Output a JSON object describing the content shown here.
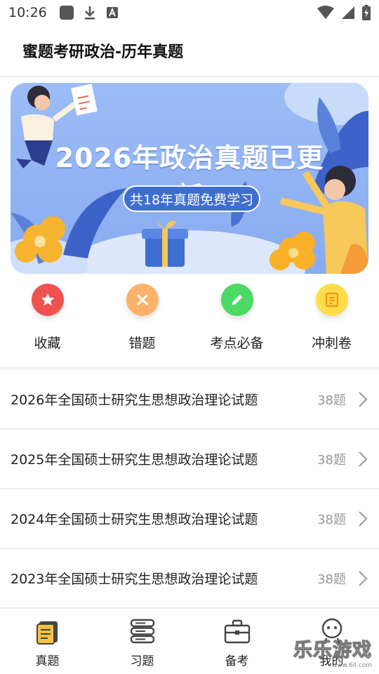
{
  "status_bar": {
    "time": "10:26"
  },
  "header": {
    "title": "蜜题考研政治-历年真题"
  },
  "banner": {
    "headline": "2026年政治真题已更新",
    "pill": "共18年真题免费学习"
  },
  "quick_actions": [
    {
      "label": "收藏",
      "icon": "star-icon",
      "color": "#ef5350"
    },
    {
      "label": "错题",
      "icon": "close-icon",
      "color": "#fbb36b"
    },
    {
      "label": "考点必备",
      "icon": "pencil-icon",
      "color": "#4cd964"
    },
    {
      "label": "冲刺卷",
      "icon": "document-icon",
      "color": "#ffdd4a"
    }
  ],
  "papers": [
    {
      "title": "2026年全国硕士研究生思想政治理论试题",
      "count": "38题"
    },
    {
      "title": "2025年全国硕士研究生思想政治理论试题",
      "count": "38题"
    },
    {
      "title": "2024年全国硕士研究生思想政治理论试题",
      "count": "38题"
    },
    {
      "title": "2023年全国硕士研究生思想政治理论试题",
      "count": "38题"
    }
  ],
  "bottom_nav": [
    {
      "label": "真题",
      "icon": "book-icon",
      "active": true
    },
    {
      "label": "习题",
      "icon": "stack-icon",
      "active": false
    },
    {
      "label": "备考",
      "icon": "briefcase-icon",
      "active": false
    },
    {
      "label": "我的",
      "icon": "profile-icon",
      "active": false
    }
  ],
  "watermark": {
    "text": "乐乐游戏",
    "sub": "www.6ll.com"
  },
  "colors": {
    "banner_blue": "#8fb2f3",
    "pill_blue": "#3f6ed1",
    "accent_yellow": "#f5c242"
  }
}
